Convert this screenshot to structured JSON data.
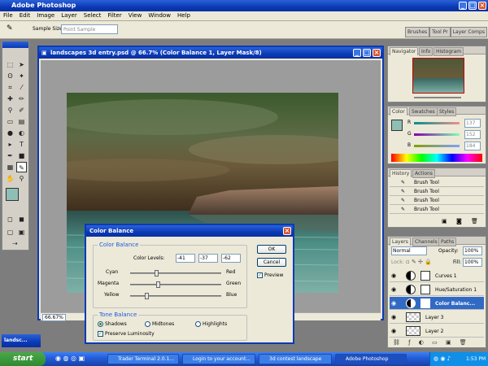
{
  "app": {
    "title": "Adobe Photoshop"
  },
  "menu": [
    "File",
    "Edit",
    "Image",
    "Layer",
    "Select",
    "Filter",
    "View",
    "Window",
    "Help"
  ],
  "options": {
    "sample_size_label": "Sample Size:",
    "sample_size_value": "Point Sample"
  },
  "well_tabs": [
    "Brushes",
    "Tool Pr",
    "Layer Comps"
  ],
  "document": {
    "title": "landscapes 3d entry.psd @ 66.7% (Color Balance 1, Layer Mask/8)",
    "zoom": "66.67%"
  },
  "color_balance": {
    "title": "Color Balance",
    "group_label": "Color Balance",
    "levels_label": "Color Levels:",
    "levels": [
      "-41",
      "-37",
      "-62"
    ],
    "level_values": [
      -41,
      -37,
      -62
    ],
    "sliders": [
      {
        "left": "Cyan",
        "right": "Red"
      },
      {
        "left": "Magenta",
        "right": "Green"
      },
      {
        "left": "Yellow",
        "right": "Blue"
      }
    ],
    "tone_label": "Tone Balance",
    "tones": [
      "Shadows",
      "Midtones",
      "Highlights"
    ],
    "selected_tone": "Shadows",
    "preserve_label": "Preserve Luminosity",
    "ok": "OK",
    "cancel": "Cancel",
    "preview": "Preview"
  },
  "navigator": {
    "tabs": [
      "Navigator",
      "Info",
      "Histogram"
    ]
  },
  "color_panel": {
    "tabs": [
      "Color",
      "Swatches",
      "Styles"
    ],
    "channels": [
      {
        "label": "R",
        "value": "137"
      },
      {
        "label": "G",
        "value": "152"
      },
      {
        "label": "B",
        "value": "184"
      }
    ]
  },
  "history": {
    "tabs": [
      "History",
      "Actions"
    ],
    "items": [
      "Brush Tool",
      "Brush Tool",
      "Brush Tool",
      "Brush Tool"
    ]
  },
  "layers": {
    "tabs": [
      "Layers",
      "Channels",
      "Paths"
    ],
    "blend_mode": "Normal",
    "opacity_label": "Opacity:",
    "opacity": "100%",
    "lock_label": "Lock:",
    "fill_label": "Fill:",
    "fill": "100%",
    "items": [
      "Curves 1",
      "Hue/Saturation 1",
      "Color Balanc...",
      "Layer 3",
      "Layer 2"
    ]
  },
  "taskbar": {
    "start": "start",
    "buttons": [
      "Trader Terminal 2.0.1...",
      "Login to your account...",
      "3d contest landscape",
      "Adobe Photoshop"
    ],
    "clock": "1:53 PM"
  },
  "minimized_doc": "landsc..."
}
